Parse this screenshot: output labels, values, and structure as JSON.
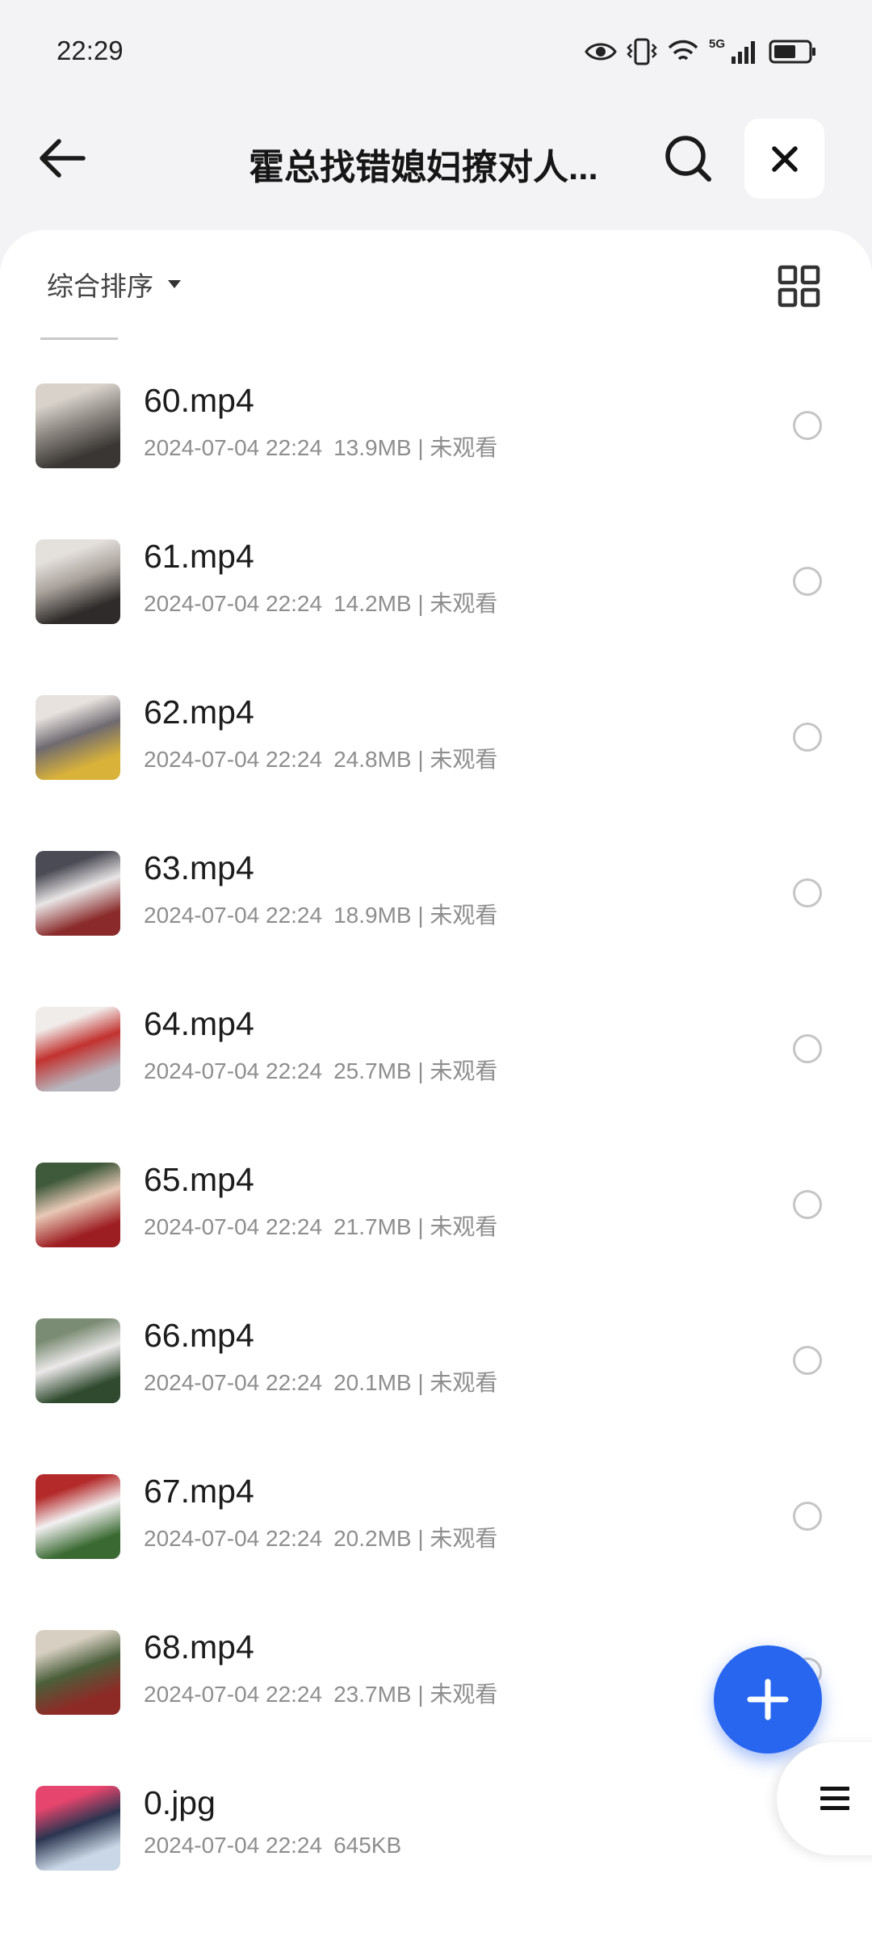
{
  "status_bar": {
    "time": "22:29",
    "network": "5G",
    "icons": [
      "eye-icon",
      "vibrate-icon",
      "wifi-icon",
      "signal-icon",
      "battery-icon"
    ]
  },
  "header": {
    "title": "霍总找错媳妇撩对人...",
    "back_icon": "arrow-left-icon",
    "search_icon": "search-icon",
    "close_icon": "close-icon"
  },
  "toolbar": {
    "sort_label": "综合排序",
    "sort_icon": "caret-down-icon",
    "view_icon": "grid-view-icon"
  },
  "files": [
    {
      "name": "60.mp4",
      "date": "2024-07-04 22:24",
      "size": "13.9MB",
      "status": "未观看",
      "thumb_colors": [
        "#3a3633",
        "#8b8680",
        "#d8d2cb"
      ]
    },
    {
      "name": "61.mp4",
      "date": "2024-07-04 22:24",
      "size": "14.2MB",
      "status": "未观看",
      "thumb_colors": [
        "#2e2b2a",
        "#a9a29b",
        "#e4e0dc"
      ]
    },
    {
      "name": "62.mp4",
      "date": "2024-07-04 22:24",
      "size": "24.8MB",
      "status": "未观看",
      "thumb_colors": [
        "#d9b23a",
        "#6f6a70",
        "#e7e2de"
      ]
    },
    {
      "name": "63.mp4",
      "date": "2024-07-04 22:24",
      "size": "18.9MB",
      "status": "未观看",
      "thumb_colors": [
        "#8a2a2a",
        "#e9e6e6",
        "#4b4b55"
      ]
    },
    {
      "name": "64.mp4",
      "date": "2024-07-04 22:24",
      "size": "25.7MB",
      "status": "未观看",
      "thumb_colors": [
        "#b7b5bd",
        "#c2322f",
        "#f0ecea"
      ]
    },
    {
      "name": "65.mp4",
      "date": "2024-07-04 22:24",
      "size": "21.7MB",
      "status": "未观看",
      "thumb_colors": [
        "#9d1e22",
        "#e8c9b7",
        "#3f5a3a"
      ]
    },
    {
      "name": "66.mp4",
      "date": "2024-07-04 22:24",
      "size": "20.1MB",
      "status": "未观看",
      "thumb_colors": [
        "#2f4a2e",
        "#ece9ea",
        "#7b8c74"
      ]
    },
    {
      "name": "67.mp4",
      "date": "2024-07-04 22:24",
      "size": "20.2MB",
      "status": "未观看",
      "thumb_colors": [
        "#3a6a32",
        "#f3f1f2",
        "#b42a2a"
      ]
    },
    {
      "name": "68.mp4",
      "date": "2024-07-04 22:24",
      "size": "23.7MB",
      "status": "未观看",
      "thumb_colors": [
        "#8e2a26",
        "#4b5f3b",
        "#d7cfc2"
      ]
    },
    {
      "name": "0.jpg",
      "date": "2024-07-04 22:24",
      "size": "645KB",
      "status": "",
      "thumb_colors": [
        "#c9d7e6",
        "#2b3550",
        "#e6456d"
      ]
    }
  ],
  "fab": {
    "icon": "plus-icon",
    "color": "#2866f0"
  },
  "side_menu": {
    "icon": "menu-icon"
  }
}
